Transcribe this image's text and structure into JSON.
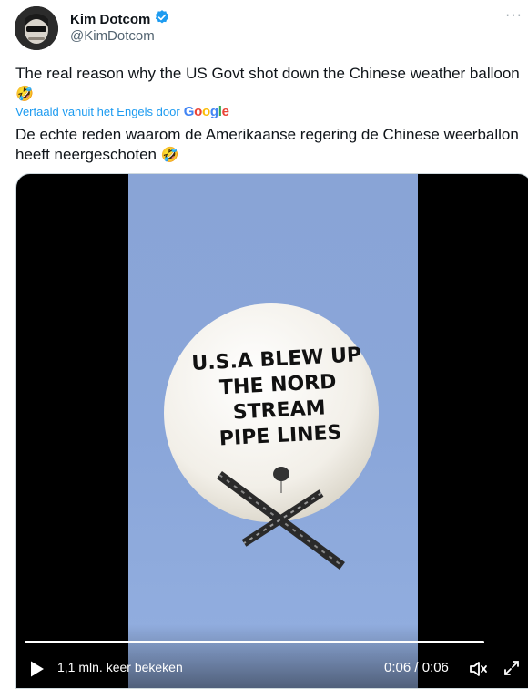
{
  "author": {
    "name": "Kim Dotcom",
    "handle": "@KimDotcom",
    "verified": true
  },
  "more_label": "···",
  "tweet": {
    "original_text": "The real reason why the US Govt shot down the Chinese weather balloon",
    "emoji": "🤣",
    "translation_notice": "Vertaald vanuit het Engels door",
    "translation_provider": "Google",
    "translated_text_line1": "De echte reden waarom de Amerikaanse regering de Chinese weerballon",
    "translated_text_line2": "heeft neergeschoten"
  },
  "video": {
    "balloon_text_lines": [
      "U.S.A BLEW UP",
      "THE NORD STREAM",
      "PIPE LINES"
    ],
    "views_label": "1,1 mln. keer bekeken",
    "time_label": "0:06 / 0:06",
    "progress": 1.0
  },
  "colors": {
    "accent": "#1d9bf0",
    "verified": "#1d9bf0",
    "sky": "#8aa6d9"
  }
}
